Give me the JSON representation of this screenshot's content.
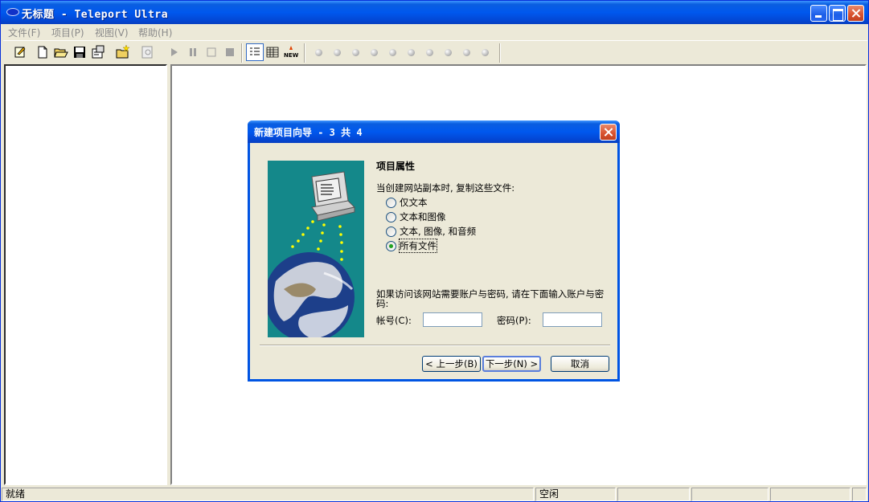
{
  "window": {
    "title": "无标题 - Teleport Ultra"
  },
  "menu": {
    "items": [
      "文件(F)",
      "项目(P)",
      "视图(V)",
      "帮助(H)"
    ]
  },
  "toolbar": {
    "buttons": [
      "new-project-icon",
      "new-file-icon",
      "open-icon",
      "save-icon",
      "properties-icon",
      "new-folder-icon",
      "find-icon",
      "play-icon",
      "pause-icon",
      "stop-outline-icon",
      "stop-icon",
      "list-view-icon",
      "grid-view-icon",
      "new-badge-icon"
    ],
    "led_count": 10
  },
  "status": {
    "left": "就绪",
    "center": "空闲"
  },
  "dialog": {
    "title": "新建项目向导 - 3 共 4",
    "section_title": "项目属性",
    "prompt": "当创建网站副本时, 复制这些文件:",
    "options": [
      {
        "label": "仅文本",
        "selected": false
      },
      {
        "label": "文本和图像",
        "selected": false
      },
      {
        "label": "文本, 图像, 和音频",
        "selected": false
      },
      {
        "label": "所有文件",
        "selected": true
      }
    ],
    "account_note": "如果访问该网站需要账户与密码, 请在下面输入账户与密码:",
    "account_label": "帐号(C):",
    "account_value": "",
    "password_label": "密码(P):",
    "password_value": "",
    "back_button": "< 上一步(B)",
    "next_button": "下一步(N) >",
    "cancel_button": "取消"
  },
  "colors": {
    "titlebar": "#0058ee",
    "wizard_background": "#14888a",
    "window_background": "#ece9d8"
  }
}
